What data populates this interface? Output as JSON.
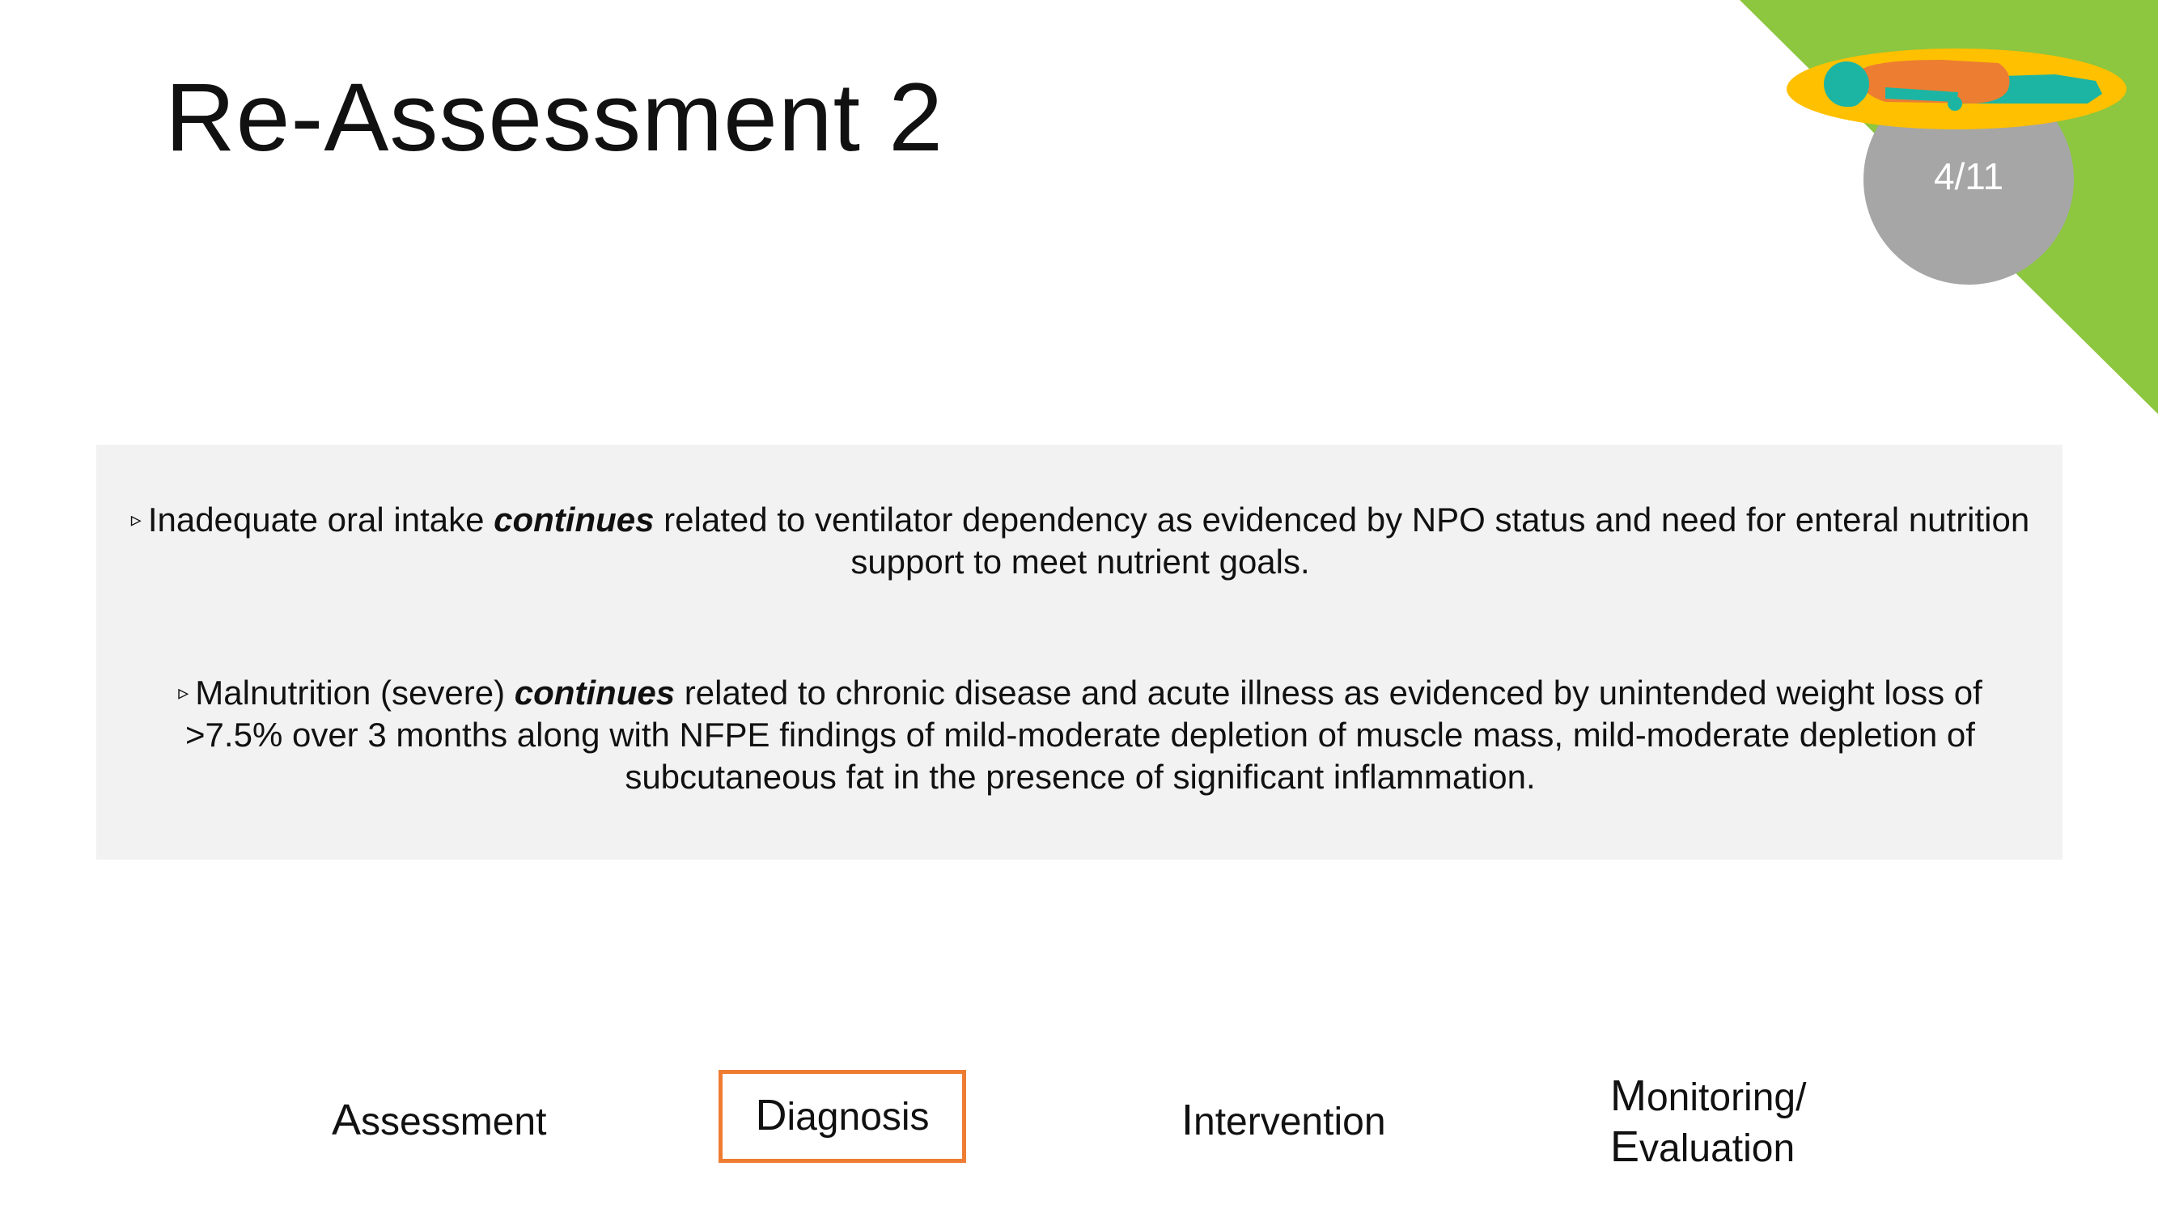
{
  "slide": {
    "title": "Re-Assessment 2",
    "number": "4/11"
  },
  "colors": {
    "accent_green": "#8dc63f",
    "badge_gray": "#a6a6a6",
    "plate_yellow": "#ffc000",
    "figure_orange": "#ed7d31",
    "figure_teal": "#1cb5a4",
    "box_background": "#f2f2f2",
    "highlight_border": "#ee7d33"
  },
  "icons": {
    "corner": "patient-lying-on-plate-icon"
  },
  "diagnoses": [
    {
      "marker": "▹",
      "before": "Inadequate oral intake ",
      "emphasis": "continues",
      "after": " related to ventilator dependency as evidenced by NPO status and need for enteral nutrition support to meet nutrient goals."
    },
    {
      "marker": "▹",
      "before": "Malnutrition (severe) ",
      "emphasis": "continues",
      "after": " related to chronic disease and acute illness as evidenced by unintended weight loss of >7.5% over 3 months along with NFPE findings of mild-moderate depletion of muscle mass, mild-moderate depletion of subcutaneous fat in the presence of significant inflammation."
    }
  ],
  "process_steps": [
    {
      "initial": "A",
      "rest": "ssessment"
    },
    {
      "initial": "D",
      "rest": "iagnosis",
      "active": true
    },
    {
      "initial": "I",
      "rest": "ntervention"
    },
    {
      "initial": "M",
      "rest": "onitoring/",
      "initial2": "E",
      "rest2": "valuation"
    }
  ]
}
